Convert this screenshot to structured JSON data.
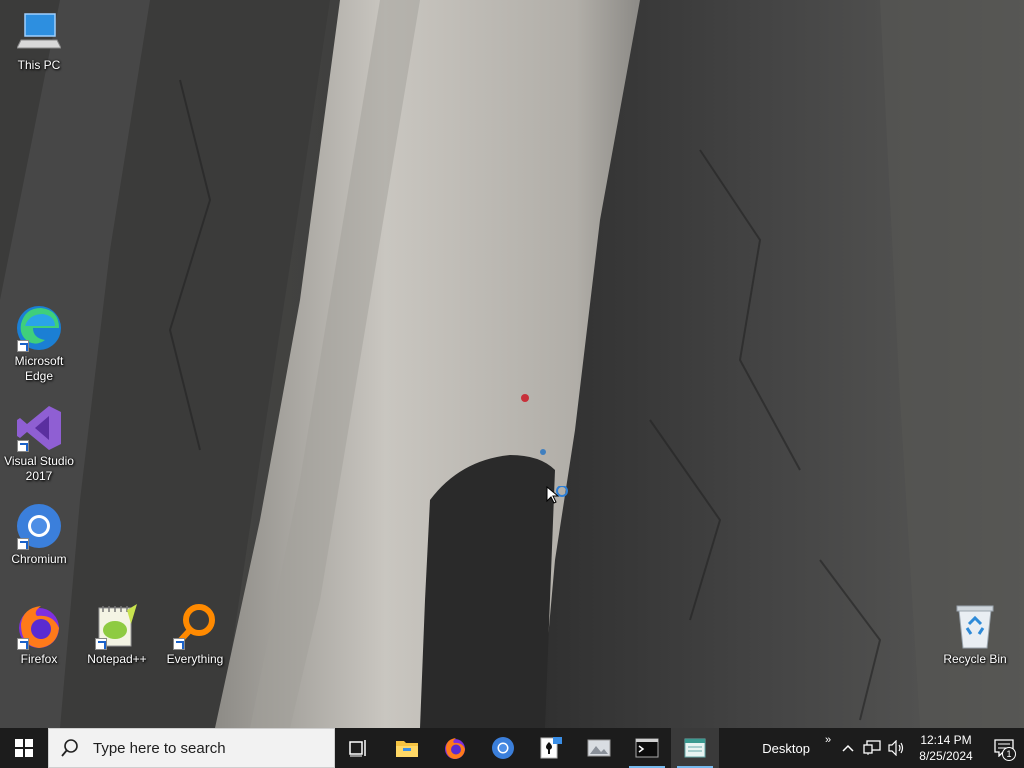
{
  "desktop": {
    "icons": [
      {
        "name": "this-pc",
        "label": "This PC",
        "icon": "computer-icon"
      },
      {
        "name": "microsoft-edge",
        "label": "Microsoft\nEdge",
        "icon": "edge-icon"
      },
      {
        "name": "visual-studio",
        "label": "Visual Studio\n2017",
        "icon": "visual-studio-icon"
      },
      {
        "name": "chromium",
        "label": "Chromium",
        "icon": "chromium-icon"
      },
      {
        "name": "firefox",
        "label": "Firefox",
        "icon": "firefox-icon"
      },
      {
        "name": "notepadpp",
        "label": "Notepad++",
        "icon": "notepadpp-icon"
      },
      {
        "name": "everything",
        "label": "Everything",
        "icon": "everything-icon"
      },
      {
        "name": "recycle-bin",
        "label": "Recycle Bin",
        "icon": "recycle-bin-icon"
      }
    ]
  },
  "taskbar": {
    "search_placeholder": "Type here to search",
    "apps": [
      "task-view-icon",
      "file-explorer-icon",
      "firefox-icon",
      "chromium-icon",
      "solitaire-icon",
      "photos-icon",
      "terminal-icon",
      "notepad-icon"
    ],
    "desktop_label": "Desktop",
    "time": "12:14 PM",
    "date": "8/25/2024",
    "notification_count": "1"
  },
  "popup": {
    "partial_text": "...   ...   ...  ...   ..."
  },
  "colors": {
    "taskbar": "#1c1c1c",
    "accent": "#76b9ed",
    "search_bg": "#f2f2f2"
  }
}
